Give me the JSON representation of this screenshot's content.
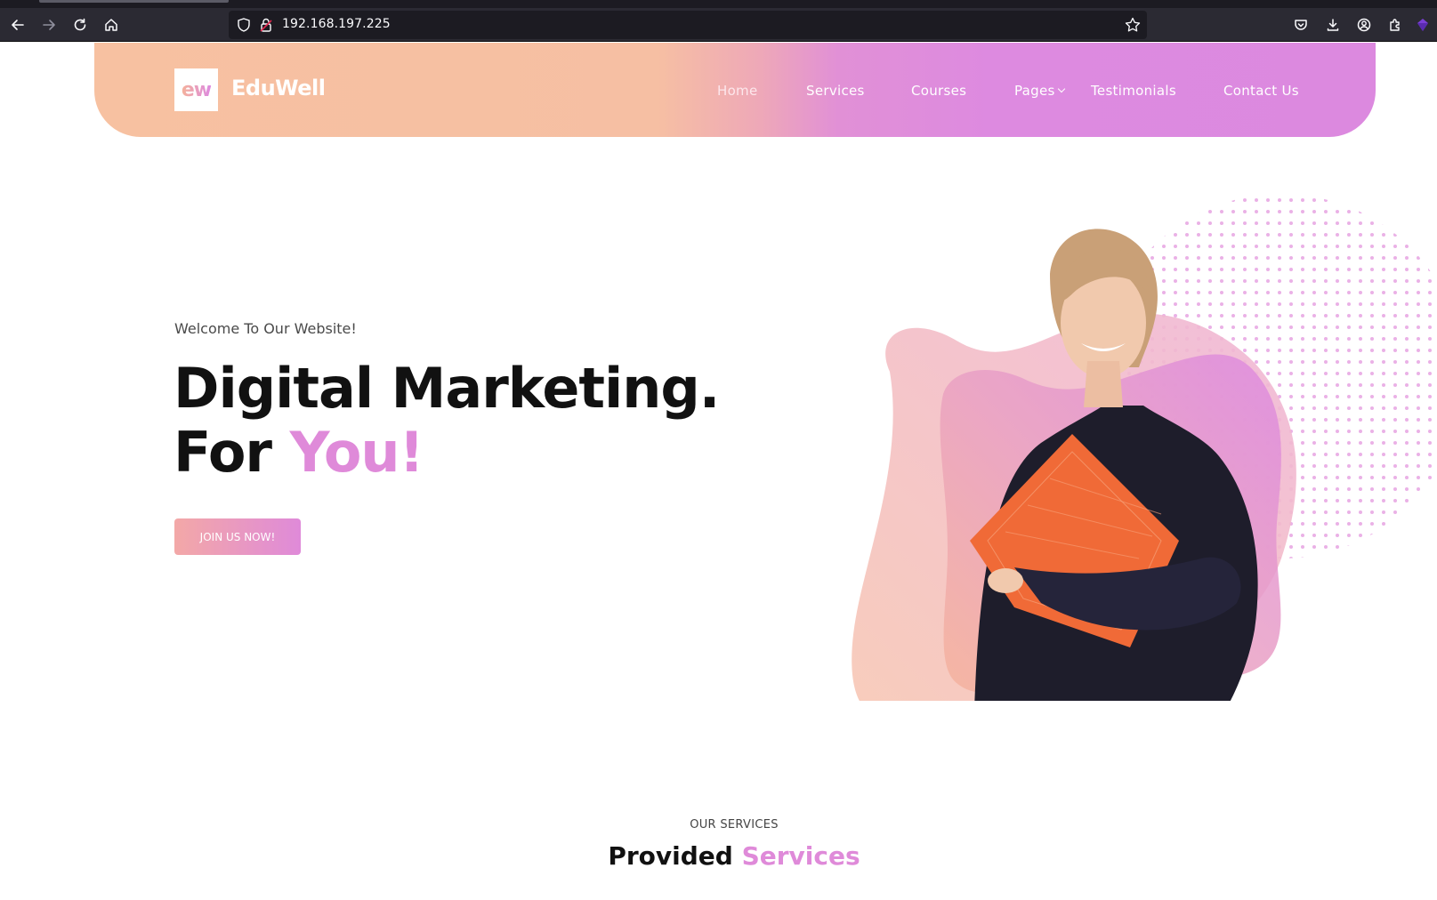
{
  "browser": {
    "url": "192.168.197.225"
  },
  "site": {
    "logo_text": "ew",
    "brand": "EduWell",
    "nav": [
      {
        "label": "Home"
      },
      {
        "label": "Services"
      },
      {
        "label": "Courses"
      },
      {
        "label": "Pages"
      },
      {
        "label": "Testimonials"
      },
      {
        "label": "Contact Us"
      }
    ]
  },
  "hero": {
    "welcome": "Welcome To Our Website!",
    "line1": "Digital Marketing.",
    "line2_prefix": "For ",
    "line2_accent": "You!",
    "cta": "JOIN US NOW!"
  },
  "services": {
    "label": "OUR SERVICES",
    "title_prefix": "Provided ",
    "title_accent": "Services"
  },
  "colors": {
    "accent_pink": "#df8ad9",
    "header_peach": "#f7c1a1",
    "header_purple": "#dc89df"
  }
}
